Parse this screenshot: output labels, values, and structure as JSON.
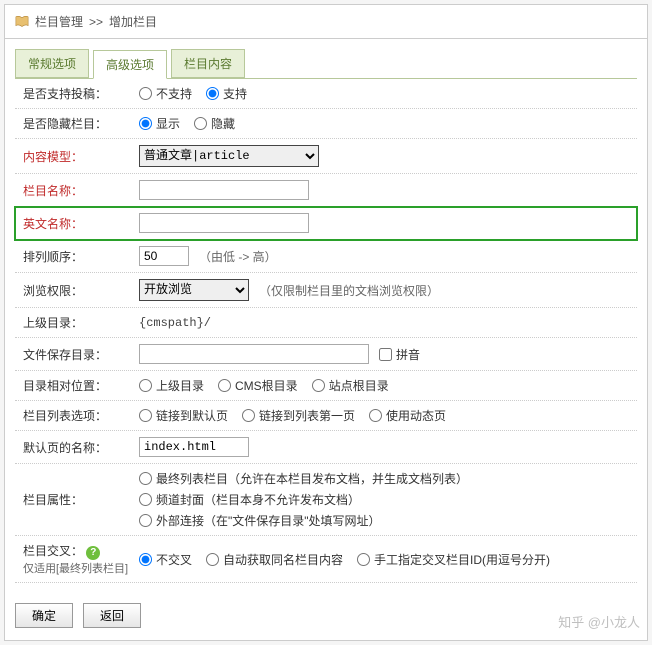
{
  "breadcrumb": {
    "root": "栏目管理",
    "current": "增加栏目"
  },
  "tabs": [
    {
      "label": "常规选项"
    },
    {
      "label": "高级选项"
    },
    {
      "label": "栏目内容"
    }
  ],
  "rows": {
    "support_submit": {
      "label": "是否支持投稿：",
      "options": [
        "不支持",
        "支持"
      ]
    },
    "hide_column": {
      "label": "是否隐藏栏目：",
      "options": [
        "显示",
        "隐藏"
      ]
    },
    "content_model": {
      "label": "内容模型：",
      "value": "普通文章|article"
    },
    "column_name": {
      "label": "栏目名称：",
      "value": ""
    },
    "english_name": {
      "label": "英文名称：",
      "value": ""
    },
    "sort_order": {
      "label": "排列顺序：",
      "value": "50",
      "hint": "（由低 -> 高）"
    },
    "browse_perm": {
      "label": "浏览权限：",
      "value": "开放浏览",
      "hint": "（仅限制栏目里的文档浏览权限）"
    },
    "parent_dir": {
      "label": "上级目录：",
      "value": "{cmspath}/"
    },
    "file_dir": {
      "label": "文件保存目录：",
      "value": "",
      "checkbox": "拼音"
    },
    "dir_relative": {
      "label": "目录相对位置：",
      "options": [
        "上级目录",
        "CMS根目录",
        "站点根目录"
      ]
    },
    "list_option": {
      "label": "栏目列表选项：",
      "options": [
        "链接到默认页",
        "链接到列表第一页",
        "使用动态页"
      ]
    },
    "default_page": {
      "label": "默认页的名称：",
      "value": "index.html"
    },
    "column_attr": {
      "label": "栏目属性：",
      "options": [
        "最终列表栏目（允许在本栏目发布文档，并生成文档列表）",
        "频道封面（栏目本身不允许发布文档）",
        "外部连接（在\"文件保存目录\"处填写网址）"
      ]
    },
    "cross": {
      "label": "栏目交叉：",
      "subnote": "仅适用[最终列表栏目]",
      "options": [
        "不交叉",
        "自动获取同名栏目内容",
        "手工指定交叉栏目ID(用逗号分开)"
      ]
    }
  },
  "actions": {
    "submit": "确定",
    "back": "返回"
  },
  "watermark": "知乎 @小龙人"
}
